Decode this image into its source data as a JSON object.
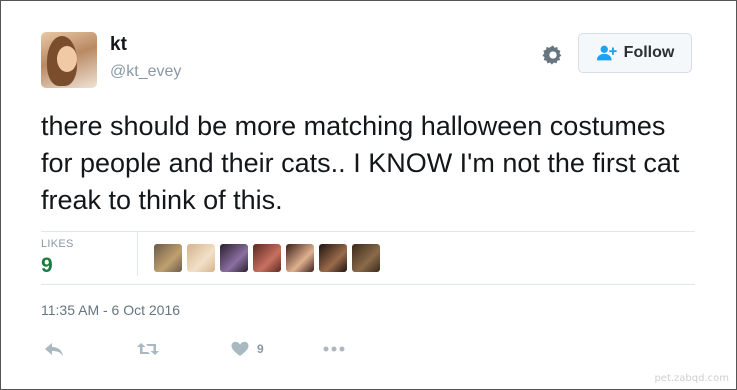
{
  "user": {
    "display_name": "kt",
    "handle": "@kt_evey"
  },
  "header": {
    "follow_label": "Follow"
  },
  "tweet": {
    "text": "there should be more matching halloween costumes for people and their cats.. I KNOW I'm not the first cat freak to think of this."
  },
  "stats": {
    "likes_label": "LIKES",
    "likes_count": "9"
  },
  "likers": [
    {
      "colors": [
        "#6b5a4a",
        "#c0a070"
      ]
    },
    {
      "colors": [
        "#d4b48c",
        "#f2e0c8"
      ]
    },
    {
      "colors": [
        "#2a1f2e",
        "#8a6fa0"
      ]
    },
    {
      "colors": [
        "#5a2a20",
        "#c87060"
      ]
    },
    {
      "colors": [
        "#3a2018",
        "#e0b090"
      ]
    },
    {
      "colors": [
        "#1e1410",
        "#9a6a4a"
      ]
    },
    {
      "colors": [
        "#3a2a1a",
        "#8a6a4a"
      ]
    }
  ],
  "meta": {
    "timestamp": "11:35 AM - 6 Oct 2016"
  },
  "actions": {
    "like_count": "9"
  },
  "icons": [
    "gear-icon",
    "follow-person-icon",
    "reply-icon",
    "retweet-icon",
    "heart-icon",
    "more-icon"
  ],
  "colors": {
    "likes_count": "#1a7d3f",
    "muted": "#8899a6",
    "action_icon": "#aab8c2",
    "follow_icon": "#1da1f2"
  },
  "watermark": "pet.zabqd.com"
}
